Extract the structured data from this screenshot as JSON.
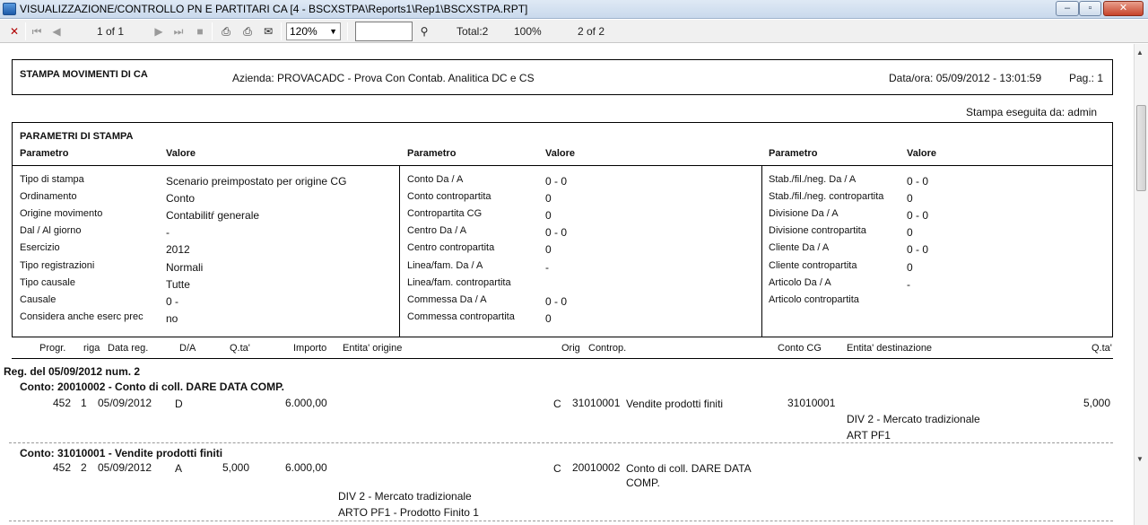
{
  "window": {
    "title": "VISUALIZZAZIONE/CONTROLLO PN E PARTITARI CA [4 - BSCXSTPA\\Reports1\\Rep1\\BSCXSTPA.RPT]",
    "min_symbol": "–",
    "max_symbol": "▫",
    "close_symbol": "✕"
  },
  "toolbar": {
    "page_indicator": "1 of 1",
    "zoom": "120%",
    "search_value": "",
    "total": "Total:2",
    "percent": "100%",
    "records": "2 of 2"
  },
  "header": {
    "report_title": "STAMPA MOVIMENTI DI CA",
    "company": "Azienda: PROVACADC - Prova Con Contab. Analitica DC e CS",
    "datetime": "Data/ora: 05/09/2012 - 13:01:59",
    "page": "Pag.: 1",
    "executed_by": "Stampa eseguita da: admin"
  },
  "params": {
    "section_title": "PARAMETRI DI STAMPA",
    "col_param": "Parametro",
    "col_value": "Valore",
    "col1": [
      {
        "label": "Tipo di stampa",
        "value": "Scenario preimpostato per origine CG"
      },
      {
        "label": "Ordinamento",
        "value": "Conto"
      },
      {
        "label": "Origine movimento",
        "value": "Contabilitŕ generale"
      },
      {
        "label": "Dal / Al giorno",
        "value": " -"
      },
      {
        "label": "Esercizio",
        "value": "2012"
      },
      {
        "label": "Tipo registrazioni",
        "value": "Normali"
      },
      {
        "label": "Tipo causale",
        "value": "Tutte"
      },
      {
        "label": "Causale",
        "value": "0 -"
      },
      {
        "label": "Considera anche eserc prec",
        "value": "no"
      }
    ],
    "col2": [
      {
        "label": "Conto Da / A",
        "value": "0 - 0"
      },
      {
        "label": "Conto contropartita",
        "value": "0"
      },
      {
        "label": "Contropartita CG",
        "value": "0"
      },
      {
        "label": "Centro Da / A",
        "value": "0 - 0"
      },
      {
        "label": "Centro contropartita",
        "value": "0"
      },
      {
        "label": "Linea/fam. Da / A",
        "value": " -"
      },
      {
        "label": "Linea/fam. contropartita",
        "value": ""
      },
      {
        "label": "Commessa Da / A",
        "value": "0 - 0"
      },
      {
        "label": "Commessa contropartita",
        "value": "0"
      }
    ],
    "col3": [
      {
        "label": "Stab./fil./neg. Da / A",
        "value": "0 - 0"
      },
      {
        "label": "Stab./fil./neg. contropartita",
        "value": "0"
      },
      {
        "label": "Divisione Da / A",
        "value": "0 - 0"
      },
      {
        "label": "Divisione contropartita",
        "value": "0"
      },
      {
        "label": "Cliente Da / A",
        "value": "0 - 0"
      },
      {
        "label": "Cliente contropartita",
        "value": "0"
      },
      {
        "label": "Articolo Da / A",
        "value": " -"
      },
      {
        "label": "Articolo contropartita",
        "value": ""
      }
    ]
  },
  "columns": {
    "progr": "Progr.",
    "riga": "riga",
    "data_reg": "Data reg.",
    "da": "D/A",
    "qta": "Q.ta'",
    "importo": "Importo",
    "entita_origine": "Entita' origine",
    "orig": "Orig",
    "controp": "Controp.",
    "conto_cg": "Conto CG",
    "entita_dest": "Entita' destinazione",
    "qta2": "Q.ta'"
  },
  "registration": {
    "title": "Reg. del 05/09/2012 num. 2",
    "groups": [
      {
        "account": "Conto: 20010002 - Conto di coll. DARE DATA COMP.",
        "row": {
          "progr": "452",
          "riga": "1",
          "date": "05/09/2012",
          "da": "D",
          "qta": "",
          "importo": "6.000,00",
          "orig": "C",
          "controp_code": "31010001",
          "controp_desc": "Vendite prodotti finiti",
          "conto_cg": "31010001",
          "qta2": "5,000"
        },
        "origin_lines": [],
        "dest_lines": [
          "DIV 2 - Mercato tradizionale",
          "ART PF1"
        ]
      },
      {
        "account": "Conto: 31010001 - Vendite prodotti finiti",
        "row": {
          "progr": "452",
          "riga": "2",
          "date": "05/09/2012",
          "da": "A",
          "qta": "5,000",
          "importo": "6.000,00",
          "orig": "C",
          "controp_code": "20010002",
          "controp_desc": "Conto di coll. DARE DATA",
          "controp_desc2": "COMP.",
          "conto_cg": "",
          "qta2": ""
        },
        "origin_lines": [
          "DIV 2 - Mercato tradizionale",
          "ARTO PF1 - Prodotto Finito 1"
        ],
        "dest_lines": []
      }
    ]
  }
}
